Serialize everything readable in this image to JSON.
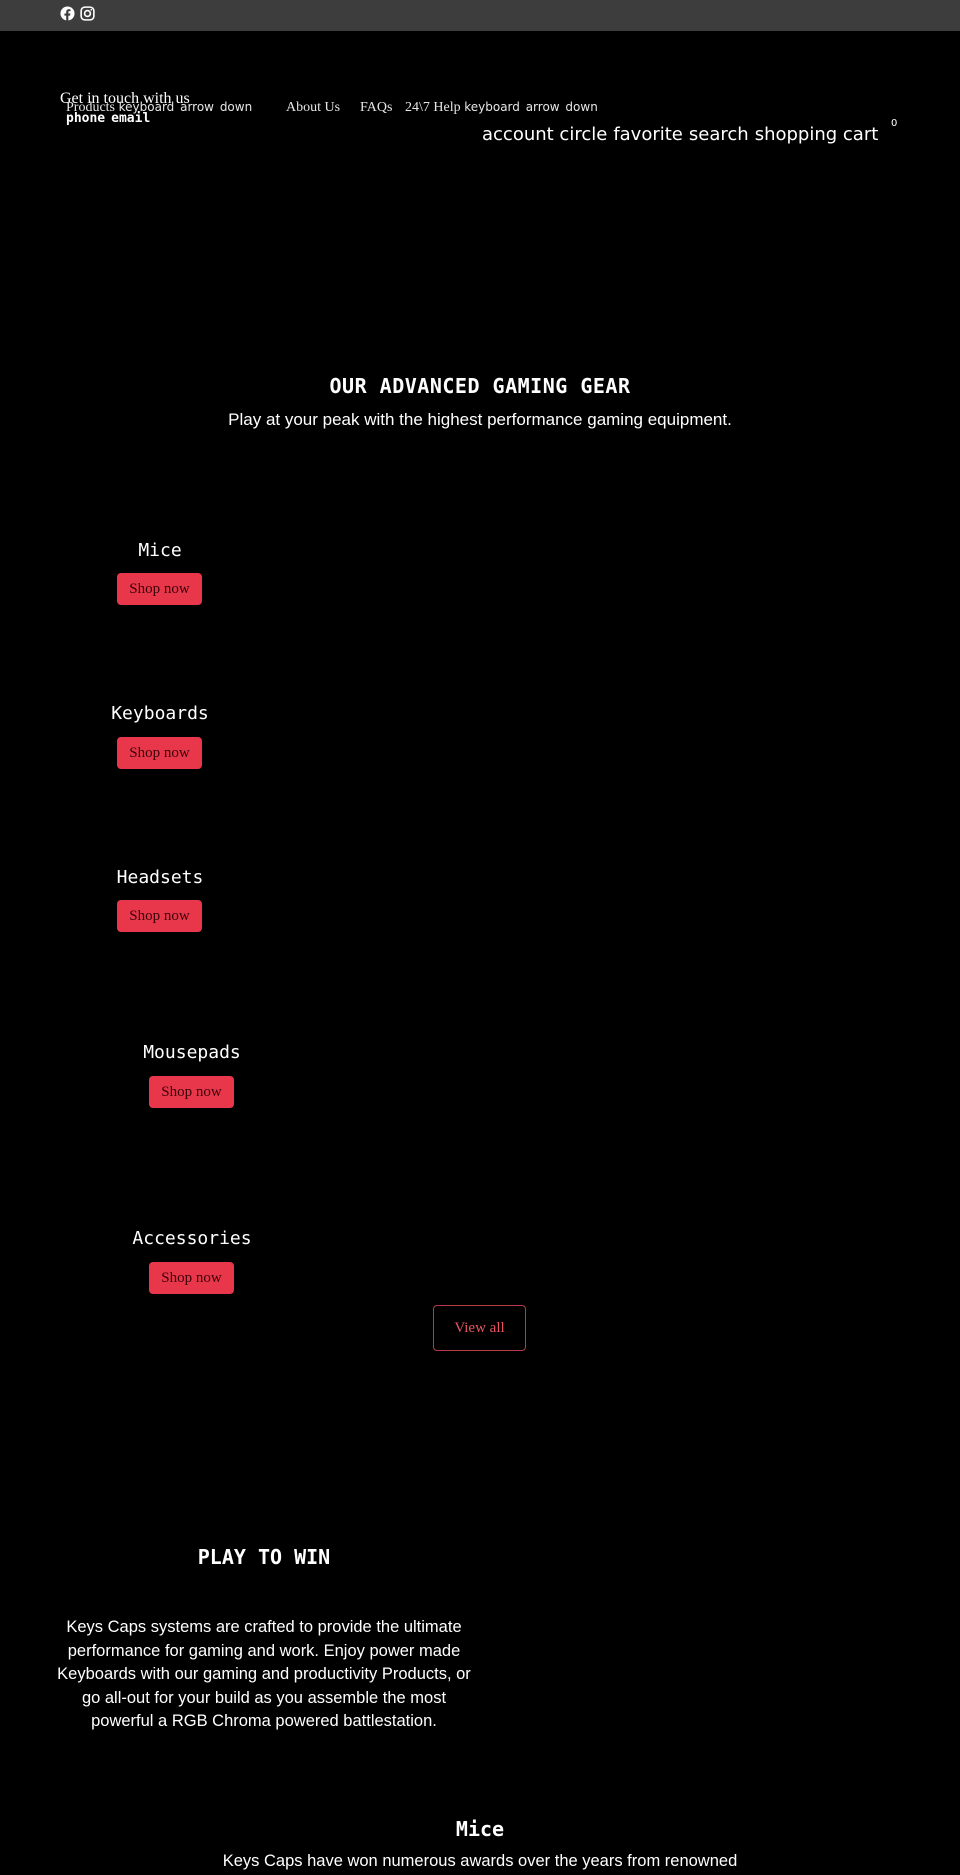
{
  "topbar": {
    "icons": [
      "facebook-icon",
      "instagram-icon"
    ],
    "background": "#3d3d3d"
  },
  "contact": {
    "title": "Get in touch with us",
    "phone": "phone",
    "email": "email"
  },
  "nav": {
    "products": "Products",
    "products_icon": "keyboard_arrow_down",
    "about": "About Us",
    "faqs": "FAQs",
    "help": "24\\7 Help",
    "help_icon": "keyboard_arrow_down"
  },
  "header_icons": {
    "account": "account_circle",
    "favorite": "favorite",
    "search": "search",
    "cart": "shopping_cart",
    "cart_count": "0"
  },
  "hero": {
    "title": "OUR ADVANCED GAMING GEAR",
    "subtitle": "Play at your peak with the highest performance gaming equipment."
  },
  "categories": [
    {
      "title": "Mice",
      "button": "Shop now"
    },
    {
      "title": "Keyboards",
      "button": "Shop now"
    },
    {
      "title": "Headsets",
      "button": "Shop now"
    },
    {
      "title": "Mousepads",
      "button": "Shop now"
    },
    {
      "title": "Accessories",
      "button": "Shop now"
    }
  ],
  "view_all": "View all",
  "play": {
    "title": "PLAY TO WIN",
    "body": "Keys Caps systems are crafted to provide the ultimate performance for gaming and work. Enjoy power made Keyboards with our gaming and productivity Products, or go all-out for your build as you assemble the most powerful a RGB Chroma powered battlestation."
  },
  "mice_section": {
    "title": "Mice",
    "subtitle": "Keys Caps have won numerous awards over the years from renowned"
  },
  "colors": {
    "accent": "#e8374b",
    "background": "#000000"
  }
}
